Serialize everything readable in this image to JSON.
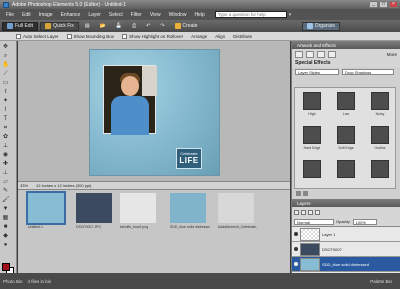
{
  "window": {
    "title": "Adobe Photoshop Elements 5.0 (Editor) - Untitled-1"
  },
  "menubar": {
    "items": [
      "File",
      "Edit",
      "Image",
      "Enhance",
      "Layer",
      "Select",
      "Filter",
      "View",
      "Window",
      "Help"
    ],
    "help_placeholder": "Type a question for help"
  },
  "shortcuts": {
    "full_edit": "Full Edit",
    "quick_fix": "Quick Fix",
    "create": "Create",
    "organize": "Organize"
  },
  "options": {
    "auto_select": "Auto Select Layer",
    "bounding_box": "Show Bounding Box",
    "highlight": "Show Highlight on Rollover",
    "arrange": "Arrange",
    "align": "Align",
    "distribute": "Distribute"
  },
  "canvas": {
    "badge_small": "Celebrate",
    "badge_large": "LIFE"
  },
  "docstatus": {
    "zoom": "33%",
    "size": "12 inches x 12 inches (300 ppi)"
  },
  "photobin": {
    "thumbs": [
      {
        "caption": "Untitled-1"
      },
      {
        "caption": "DSCF0007.JPG"
      },
      {
        "caption": "kshoffs_bow2.png"
      },
      {
        "caption": "SDD_blue solid distressed"
      },
      {
        "caption": "AddaMoment_Celebrate..."
      }
    ]
  },
  "panel": {
    "header": "Artwork and Effects",
    "title": "Special Effects",
    "dropdown1": "Layer Styles",
    "dropdown2": "Drop Shadows",
    "more": "More",
    "effects": [
      "High",
      "Low",
      "Noisy",
      "Hard Edge",
      "Soft Edge",
      "Outline"
    ],
    "layers_header": "Layers",
    "blend": "Normal",
    "opacity_label": "Opacity:",
    "opacity": "100%",
    "layers": [
      {
        "name": "Layer 1"
      },
      {
        "name": "DSCF0007"
      },
      {
        "name": "SDD_blue solid distressed"
      }
    ]
  },
  "status": {
    "photo_bin": "Photo Bin",
    "count": "4 files in bin",
    "palette_bin": "Palette Bin"
  }
}
